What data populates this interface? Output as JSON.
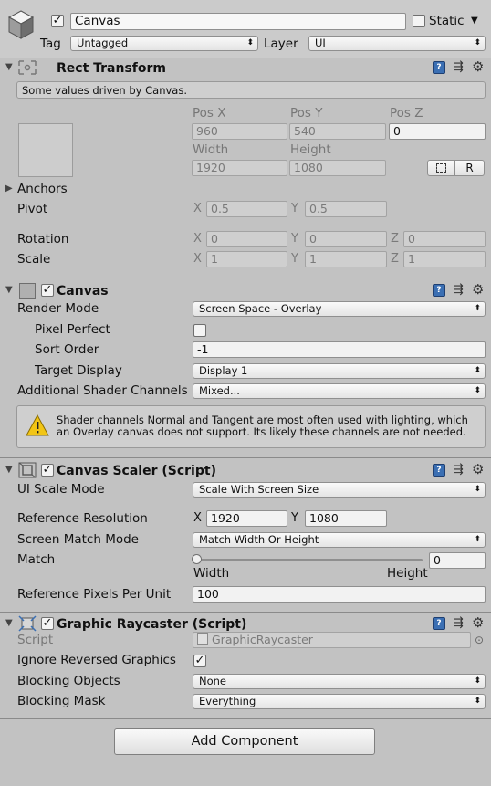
{
  "object": {
    "name": "Canvas",
    "static_label": "Static",
    "tag_label": "Tag",
    "tag_value": "Untagged",
    "layer_label": "Layer",
    "layer_value": "UI"
  },
  "rect_transform": {
    "title": "Rect Transform",
    "info": "Some values driven by Canvas.",
    "pos_x_label": "Pos X",
    "pos_y_label": "Pos Y",
    "pos_z_label": "Pos Z",
    "pos_x": "960",
    "pos_y": "540",
    "pos_z": "0",
    "width_label": "Width",
    "height_label": "Height",
    "width": "1920",
    "height": "1080",
    "r_button": "R",
    "anchors_label": "Anchors",
    "pivot_label": "Pivot",
    "pivot_x": "0.5",
    "pivot_y": "0.5",
    "rotation_label": "Rotation",
    "rot_x": "0",
    "rot_y": "0",
    "rot_z": "0",
    "scale_label": "Scale",
    "scale_x": "1",
    "scale_y": "1",
    "scale_z": "1"
  },
  "axis": {
    "x": "X",
    "y": "Y",
    "z": "Z"
  },
  "canvas": {
    "title": "Canvas",
    "render_mode_label": "Render Mode",
    "render_mode": "Screen Space - Overlay",
    "pixel_perfect_label": "Pixel Perfect",
    "sort_order_label": "Sort Order",
    "sort_order": "-1",
    "target_display_label": "Target Display",
    "target_display": "Display 1",
    "shader_channels_label": "Additional Shader Channels",
    "shader_channels": "Mixed...",
    "warning": "Shader channels Normal and Tangent are most often used with lighting, which an Overlay canvas does not support. Its likely these channels are not needed."
  },
  "scaler": {
    "title": "Canvas Scaler (Script)",
    "ui_scale_mode_label": "UI Scale Mode",
    "ui_scale_mode": "Scale With Screen Size",
    "ref_res_label": "Reference Resolution",
    "ref_res_x": "1920",
    "ref_res_y": "1080",
    "match_mode_label": "Screen Match Mode",
    "match_mode": "Match Width Or Height",
    "match_label": "Match",
    "match_value": "0",
    "match_fraction": 0,
    "width_caption": "Width",
    "height_caption": "Height",
    "ppu_label": "Reference Pixels Per Unit",
    "ppu": "100"
  },
  "raycaster": {
    "title": "Graphic Raycaster (Script)",
    "script_label": "Script",
    "script_value": "GraphicRaycaster",
    "ignore_reversed_label": "Ignore Reversed Graphics",
    "blocking_objects_label": "Blocking Objects",
    "blocking_objects": "None",
    "blocking_mask_label": "Blocking Mask",
    "blocking_mask": "Everything"
  },
  "add_component": "Add Component",
  "icons": {
    "book": "help-book-icon",
    "sliders": "preset-sliders-icon",
    "gear": "gear-icon",
    "warning": "warning-icon",
    "cube": "gameobject-cube-icon"
  },
  "colors": {
    "panel": "#c2c2c2",
    "accent": "#3b6fb3",
    "warning": "#f2c515"
  }
}
